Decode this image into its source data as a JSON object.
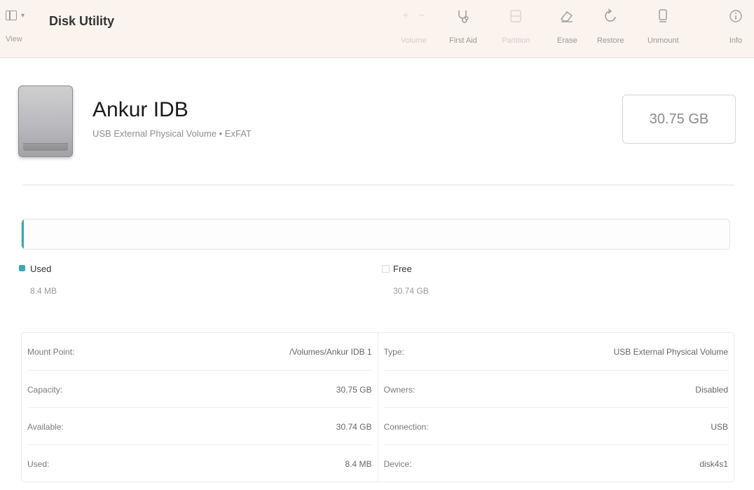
{
  "toolbar": {
    "view_label": "View",
    "title": "Disk Utility",
    "volume_label": "Volume",
    "first_aid_label": "First Aid",
    "partition_label": "Partition",
    "erase_label": "Erase",
    "restore_label": "Restore",
    "unmount_label": "Unmount",
    "info_label": "Info"
  },
  "disk": {
    "name": "Ankur IDB",
    "subtitle": "USB External Physical Volume • ExFAT",
    "capacity": "30.75 GB"
  },
  "usage": {
    "used_fraction": 0.0003,
    "used_color": "#3aa7b5",
    "free_color": "#ffffff",
    "used_label": "Used",
    "used_value": "8.4 MB",
    "free_label": "Free",
    "free_value": "30.74 GB"
  },
  "info": {
    "left": [
      {
        "key": "Mount Point:",
        "value": "/Volumes/Ankur IDB 1"
      },
      {
        "key": "Capacity:",
        "value": "30.75 GB"
      },
      {
        "key": "Available:",
        "value": "30.74 GB"
      },
      {
        "key": "Used:",
        "value": "8.4 MB"
      }
    ],
    "right": [
      {
        "key": "Type:",
        "value": "USB External Physical Volume"
      },
      {
        "key": "Owners:",
        "value": "Disabled"
      },
      {
        "key": "Connection:",
        "value": "USB"
      },
      {
        "key": "Device:",
        "value": "disk4s1"
      }
    ]
  }
}
